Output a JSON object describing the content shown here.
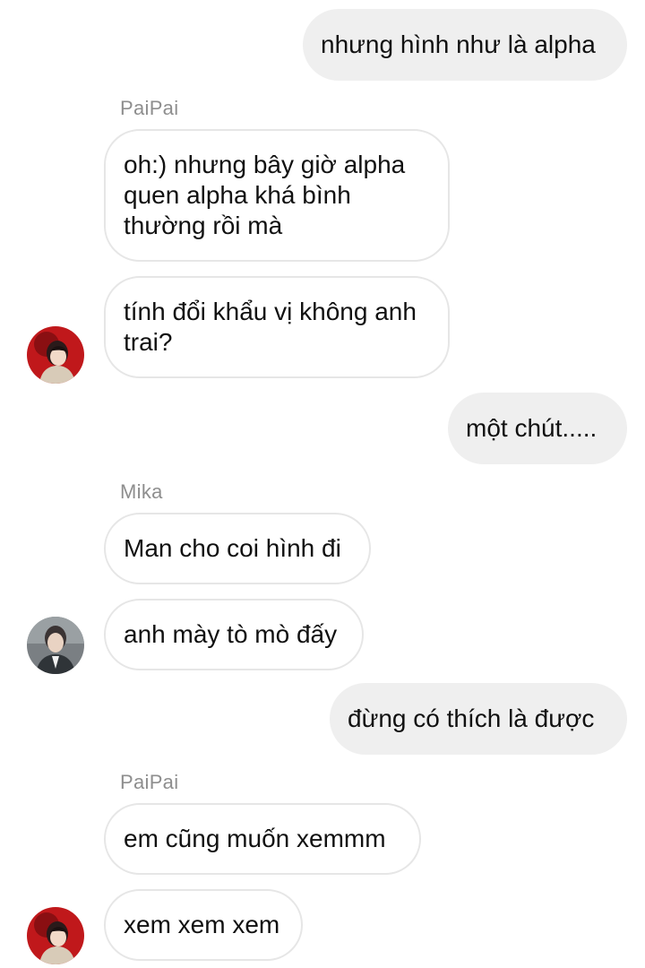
{
  "thread": {
    "messages": [
      {
        "id": "m1",
        "direction": "outgoing",
        "text": "nhưng hình như là alpha"
      },
      {
        "id": "m2",
        "direction": "incoming",
        "sender": "PaiPai",
        "text": "oh:) nhưng bây giờ alpha quen alpha khá bình thường rồi mà"
      },
      {
        "id": "m3",
        "direction": "incoming",
        "sender": "PaiPai",
        "text": "tính đổi khẩu vị không anh trai?"
      },
      {
        "id": "m4",
        "direction": "outgoing",
        "text": "một chút....."
      },
      {
        "id": "m5",
        "direction": "incoming",
        "sender": "Mika",
        "text": "Man cho coi hình đi"
      },
      {
        "id": "m6",
        "direction": "incoming",
        "sender": "Mika",
        "text": "anh mày tò mò đấy"
      },
      {
        "id": "m7",
        "direction": "outgoing",
        "text": "đừng có thích là được"
      },
      {
        "id": "m8",
        "direction": "incoming",
        "sender": "PaiPai",
        "text": "em cũng muốn xemmm"
      },
      {
        "id": "m9",
        "direction": "incoming",
        "sender": "PaiPai",
        "text": "xem xem xem"
      }
    ],
    "sender_labels": {
      "paipai_1": "PaiPai",
      "mika": "Mika",
      "paipai_2": "PaiPai"
    },
    "avatars": {
      "paipai": {
        "icon": "avatar-paipai",
        "color": "#c0181b"
      },
      "mika": {
        "icon": "avatar-mika",
        "color": "#7a7f83"
      }
    },
    "colors": {
      "outgoing_bubble": "#efefef",
      "incoming_bubble": "#ffffff",
      "incoming_border": "#e6e6e6",
      "sender_label": "#8e8e8e"
    }
  }
}
